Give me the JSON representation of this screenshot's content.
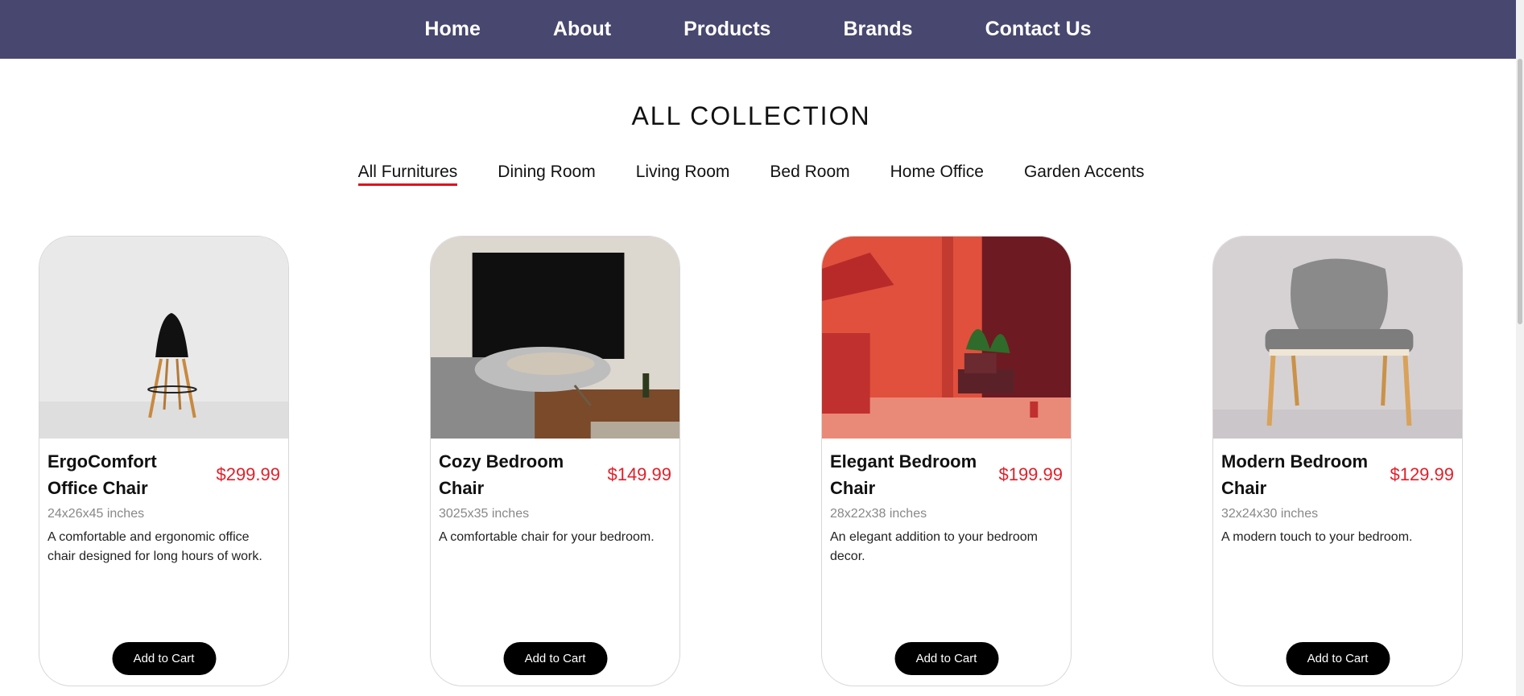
{
  "nav": {
    "items": [
      "Home",
      "About",
      "Products",
      "Brands",
      "Contact Us"
    ],
    "background": "#47476f"
  },
  "page": {
    "title": "ALL COLLECTION"
  },
  "filters": {
    "items": [
      "All Furnitures",
      "Dining Room",
      "Living Room",
      "Bed Room",
      "Home Office",
      "Garden Accents"
    ],
    "active": "All Furnitures",
    "active_color": "#e0101a"
  },
  "products": [
    {
      "name": "ErgoComfort Office Chair",
      "price": "$299.99",
      "dimensions": "24x26x45 inches",
      "description": "A comfortable and ergonomic office chair designed for long hours of work.",
      "button": "Add to Cart",
      "image": "black-chair-photo"
    },
    {
      "name": "Cozy Bedroom Chair",
      "price": "$149.99",
      "dimensions": "3025x35 inches",
      "description": "A comfortable chair for your bedroom.",
      "button": "Add to Cart",
      "image": "lounge-chair-room-photo"
    },
    {
      "name": "Elegant Bedroom Chair",
      "price": "$199.99",
      "dimensions": "28x22x38 inches",
      "description": "An elegant addition to your bedroom decor.",
      "button": "Add to Cart",
      "image": "red-room-chair-photo"
    },
    {
      "name": "Modern Bedroom Chair",
      "price": "$129.99",
      "dimensions": "32x24x30 inches",
      "description": "A modern touch to your bedroom.",
      "button": "Add to Cart",
      "image": "grey-armchair-photo"
    }
  ],
  "colors": {
    "price": "#e0202a",
    "button_bg": "#000000"
  }
}
